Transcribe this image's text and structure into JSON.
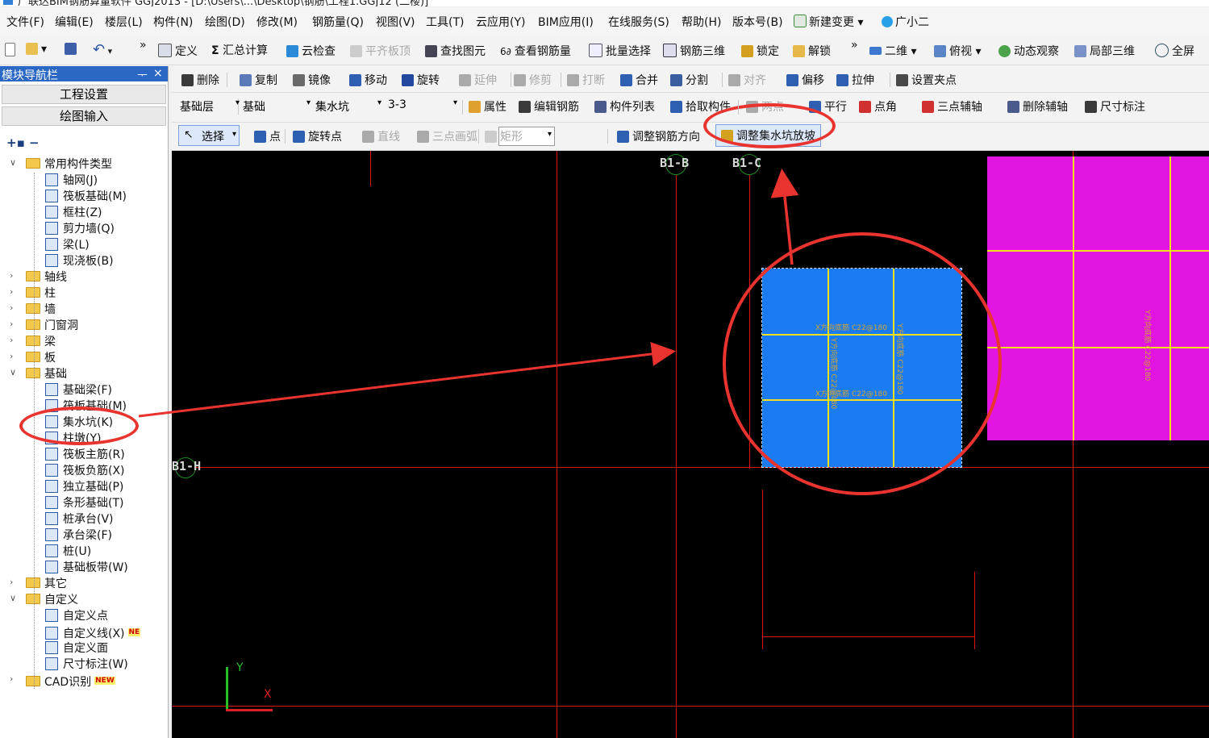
{
  "window": {
    "title": "广联达BIM钢筋算量软件 GGJ2013 - [D:\\Users\\...\\Desktop\\钢筋\\工程1.GGJ12 (二楼)]"
  },
  "menu": [
    "文件(F)",
    "编辑(E)",
    "楼层(L)",
    "构件(N)",
    "绘图(D)",
    "修改(M)",
    "钢筋量(Q)",
    "视图(V)",
    "工具(T)",
    "云应用(Y)",
    "BIM应用(I)",
    "在线服务(S)",
    "帮助(H)",
    "版本号(B)",
    "新建变更",
    "广小二"
  ],
  "toolbar1": {
    "more": "»",
    "items": [
      "定义",
      "汇总计算",
      "云检查",
      "平齐板顶",
      "查找图元",
      "查看钢筋量",
      "批量选择",
      "钢筋三维",
      "锁定",
      "解锁"
    ],
    "more2": "»",
    "view_items": [
      "二维",
      "俯视",
      "动态观察",
      "局部三维",
      "全屏"
    ]
  },
  "toolbar2": {
    "items": [
      "删除",
      "复制",
      "镜像",
      "移动",
      "旋转",
      "延伸",
      "修剪",
      "打断",
      "合并",
      "分割",
      "对齐",
      "偏移",
      "拉伸",
      "设置夹点"
    ]
  },
  "toolbar3": {
    "floor": "基础层",
    "category": "基础",
    "type": "集水坑",
    "name": "3-3",
    "items": [
      "属性",
      "编辑钢筋",
      "构件列表",
      "拾取构件",
      "两点",
      "平行",
      "点角",
      "三点辅轴",
      "删除辅轴",
      "尺寸标注"
    ]
  },
  "toolbar4": {
    "select": "选择",
    "items": [
      "点",
      "旋转点",
      "直线",
      "三点画弧",
      "矩形",
      "调整钢筋方向",
      "调整集水坑放坡"
    ]
  },
  "nav": {
    "title": "模块导航栏",
    "pin": "ᅮ",
    "close": "×",
    "btn_settings": "工程设置",
    "btn_draw": "绘图输入",
    "tree": [
      {
        "label": "常用构件类型",
        "kind": "folder",
        "level": 0,
        "open": true
      },
      {
        "label": "轴网(J)",
        "kind": "comp",
        "level": 1
      },
      {
        "label": "筏板基础(M)",
        "kind": "comp",
        "level": 1
      },
      {
        "label": "框柱(Z)",
        "kind": "comp",
        "level": 1
      },
      {
        "label": "剪力墙(Q)",
        "kind": "comp",
        "level": 1
      },
      {
        "label": "梁(L)",
        "kind": "comp",
        "level": 1
      },
      {
        "label": "现浇板(B)",
        "kind": "comp",
        "level": 1
      },
      {
        "label": "轴线",
        "kind": "folder",
        "level": 0,
        "open": false
      },
      {
        "label": "柱",
        "kind": "folder",
        "level": 0,
        "open": false
      },
      {
        "label": "墙",
        "kind": "folder",
        "level": 0,
        "open": false
      },
      {
        "label": "门窗洞",
        "kind": "folder",
        "level": 0,
        "open": false
      },
      {
        "label": "梁",
        "kind": "folder",
        "level": 0,
        "open": false
      },
      {
        "label": "板",
        "kind": "folder",
        "level": 0,
        "open": false
      },
      {
        "label": "基础",
        "kind": "folder",
        "level": 0,
        "open": true
      },
      {
        "label": "基础梁(F)",
        "kind": "comp",
        "level": 1
      },
      {
        "label": "筏板基础(M)",
        "kind": "comp",
        "level": 1
      },
      {
        "label": "集水坑(K)",
        "kind": "comp",
        "level": 1
      },
      {
        "label": "柱墩(Y)",
        "kind": "comp",
        "level": 1
      },
      {
        "label": "筏板主筋(R)",
        "kind": "comp",
        "level": 1
      },
      {
        "label": "筏板负筋(X)",
        "kind": "comp",
        "level": 1
      },
      {
        "label": "独立基础(P)",
        "kind": "comp",
        "level": 1
      },
      {
        "label": "条形基础(T)",
        "kind": "comp",
        "level": 1
      },
      {
        "label": "桩承台(V)",
        "kind": "comp",
        "level": 1
      },
      {
        "label": "承台梁(F)",
        "kind": "comp",
        "level": 1
      },
      {
        "label": "桩(U)",
        "kind": "comp",
        "level": 1
      },
      {
        "label": "基础板带(W)",
        "kind": "comp",
        "level": 1
      },
      {
        "label": "其它",
        "kind": "folder",
        "level": 0,
        "open": false
      },
      {
        "label": "自定义",
        "kind": "folder",
        "level": 0,
        "open": true
      },
      {
        "label": "自定义点",
        "kind": "comp",
        "level": 1
      },
      {
        "label": "自定义线(X)",
        "kind": "comp",
        "level": 1,
        "badge": "NE"
      },
      {
        "label": "自定义面",
        "kind": "comp",
        "level": 1
      },
      {
        "label": "尺寸标注(W)",
        "kind": "comp",
        "level": 1
      },
      {
        "label": "CAD识别",
        "kind": "folder",
        "level": 0,
        "open": false,
        "badge": "NEW"
      }
    ]
  },
  "canvas": {
    "axes": {
      "b1b": "B1-B",
      "b1c": "B1-C",
      "b1h": "B1-H"
    },
    "pit_labels": {
      "x_bottom_1": "X方向底筋 C22@180",
      "x_bottom_2": "X方向底筋 C22@180",
      "y_bottom_1": "Y方向底筋 C22@180",
      "y_bottom_2": "Y方向底筋 C22@180"
    },
    "slab_label": "Y方向底筋 C22@180",
    "ucs": {
      "x": "X",
      "y": "Y"
    }
  },
  "colors": {
    "canvas_bg": "#000000",
    "axis_line": "#dd1111",
    "pit_fill": "#1a7cf0",
    "slab_fill": "#e214e2",
    "rebar_line": "#f0e020",
    "annotation": "#e8332f",
    "nav_title_bg": "#2b67c4"
  }
}
